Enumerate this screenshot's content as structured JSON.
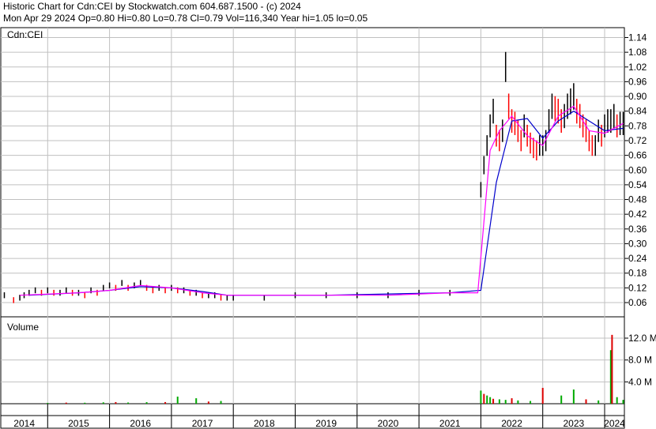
{
  "header": {
    "line1": "Historic Chart for Cdn:CEI by Stockwatch.com 604.687.1500 - (c) 2024",
    "line2": "Mon Apr 29 2024  Op=0.80  Hi=0.80  Lo=0.78  Cl=0.79  Vol=116,340  Year hi=1.05  lo=0.05"
  },
  "colors": {
    "price": "#000000",
    "down_tick": "#ff0000",
    "ma_short": "#ff00ff",
    "ma_long": "#0000cc",
    "vol_up": "#00aa00",
    "vol_down": "#dd0000",
    "grid": "#c0c0c0"
  },
  "chart_data": [
    {
      "type": "line",
      "title": "Cdn:CEI",
      "ylim": [
        0,
        1.16
      ],
      "y_ticks": [
        "1.14",
        "1.08",
        "1.02",
        "0.96",
        "0.90",
        "0.84",
        "0.78",
        "0.72",
        "0.66",
        "0.60",
        "0.54",
        "0.48",
        "0.42",
        "0.36",
        "0.30",
        "0.24",
        "0.18",
        "0.12",
        "0.06"
      ],
      "x_labels": [
        "2014",
        "2015",
        "2016",
        "2017",
        "2018",
        "2019",
        "2020",
        "2021",
        "2022",
        "2023",
        "2024"
      ],
      "series": [
        {
          "x": [
            2014.0,
            2014.1,
            2014.2,
            2014.3,
            2014.45,
            2014.55,
            2014.62,
            2014.7,
            2014.8,
            2014.9,
            2015.0,
            2015.1,
            2015.2,
            2015.3,
            2015.4,
            2015.5,
            2015.6,
            2015.7,
            2015.8,
            2015.9,
            2016.0,
            2016.1,
            2016.2,
            2016.3,
            2016.4,
            2016.5,
            2016.6,
            2016.7,
            2016.8,
            2016.9,
            2017.0,
            2017.1,
            2017.2,
            2017.3,
            2017.4,
            2017.5,
            2017.6,
            2017.7,
            2017.8,
            2017.9,
            2018.0,
            2018.5,
            2019.0,
            2019.5,
            2020.0,
            2020.5,
            2021.0,
            2021.5,
            2022.0,
            2022.05,
            2022.1,
            2022.15,
            2022.2,
            2022.25,
            2022.3,
            2022.35,
            2022.4,
            2022.45,
            2022.5,
            2022.55,
            2022.6,
            2022.65,
            2022.7,
            2022.75,
            2022.8,
            2022.85,
            2022.9,
            2022.95,
            2023.0,
            2023.05,
            2023.1,
            2023.15,
            2023.2,
            2023.25,
            2023.3,
            2023.35,
            2023.4,
            2023.45,
            2023.5,
            2023.55,
            2023.6,
            2023.65,
            2023.7,
            2023.75,
            2023.8,
            2023.85,
            2023.9,
            2023.95,
            2024.0,
            2024.05,
            2024.1,
            2024.15,
            2024.2,
            2024.25,
            2024.3
          ],
          "values": [
            0.1,
            0.09,
            0.08,
            0.09,
            0.07,
            0.08,
            0.09,
            0.1,
            0.11,
            0.1,
            0.11,
            0.1,
            0.1,
            0.11,
            0.1,
            0.1,
            0.09,
            0.11,
            0.1,
            0.12,
            0.13,
            0.12,
            0.14,
            0.12,
            0.13,
            0.14,
            0.12,
            0.11,
            0.12,
            0.11,
            0.12,
            0.11,
            0.11,
            0.1,
            0.1,
            0.09,
            0.09,
            0.09,
            0.08,
            0.08,
            0.08,
            0.08,
            0.09,
            0.09,
            0.09,
            0.09,
            0.1,
            0.1,
            0.52,
            0.62,
            0.7,
            0.78,
            0.84,
            0.74,
            0.72,
            0.76,
            1.02,
            0.86,
            0.8,
            0.79,
            0.76,
            0.72,
            0.78,
            0.74,
            0.71,
            0.69,
            0.68,
            0.7,
            0.7,
            0.72,
            0.8,
            0.86,
            0.85,
            0.84,
            0.8,
            0.82,
            0.86,
            0.88,
            0.9,
            0.84,
            0.82,
            0.78,
            0.76,
            0.72,
            0.7,
            0.7,
            0.76,
            0.74,
            0.78,
            0.8,
            0.8,
            0.82,
            0.78,
            0.79,
            0.79
          ]
        },
        {
          "x": [
            2014.55,
            2015.5,
            2016.0,
            2016.5,
            2017.0,
            2017.5,
            2017.9,
            2018.5,
            2019.5,
            2020.5,
            2021.5,
            2021.95,
            2022.15,
            2022.3,
            2022.5,
            2022.75,
            2023.0,
            2023.25,
            2023.5,
            2023.75,
            2024.0,
            2024.3
          ],
          "values": [
            0.09,
            0.1,
            0.11,
            0.13,
            0.12,
            0.1,
            0.09,
            0.09,
            0.09,
            0.09,
            0.1,
            0.1,
            0.68,
            0.76,
            0.82,
            0.74,
            0.7,
            0.82,
            0.86,
            0.76,
            0.75,
            0.79
          ]
        },
        {
          "x": [
            2014.7,
            2015.5,
            2016.0,
            2016.5,
            2017.0,
            2017.5,
            2017.9,
            2018.5,
            2019.5,
            2020.5,
            2021.5,
            2022.0,
            2022.25,
            2022.5,
            2022.75,
            2023.0,
            2023.25,
            2023.5,
            2023.75,
            2024.0,
            2024.3
          ],
          "values": [
            0.09,
            0.1,
            0.11,
            0.125,
            0.12,
            0.105,
            0.09,
            0.09,
            0.09,
            0.095,
            0.1,
            0.11,
            0.55,
            0.8,
            0.81,
            0.73,
            0.8,
            0.84,
            0.8,
            0.76,
            0.77
          ]
        }
      ]
    },
    {
      "type": "bar",
      "title": "Volume",
      "ylim": [
        0,
        14000000
      ],
      "y_ticks": [
        "12.0 M",
        "8.0 M",
        "4.0 M"
      ],
      "x": [
        2015.0,
        2015.3,
        2015.6,
        2015.9,
        2016.1,
        2016.3,
        2016.6,
        2016.9,
        2017.1,
        2017.4,
        2017.6,
        2017.8,
        2022.0,
        2022.05,
        2022.1,
        2022.15,
        2022.2,
        2022.3,
        2022.4,
        2022.5,
        2022.6,
        2022.8,
        2023.0,
        2023.3,
        2023.5,
        2023.7,
        2023.9,
        2024.1,
        2024.12,
        2024.2,
        2024.3
      ],
      "values": [
        150000,
        200000,
        180000,
        250000,
        300000,
        220000,
        280000,
        300000,
        1300000,
        1000000,
        400000,
        500000,
        2400000,
        1800000,
        1500000,
        1200000,
        900000,
        800000,
        700000,
        1000000,
        600000,
        500000,
        2900000,
        1500000,
        2600000,
        800000,
        600000,
        9800000,
        12600000,
        1200000,
        700000
      ]
    }
  ]
}
